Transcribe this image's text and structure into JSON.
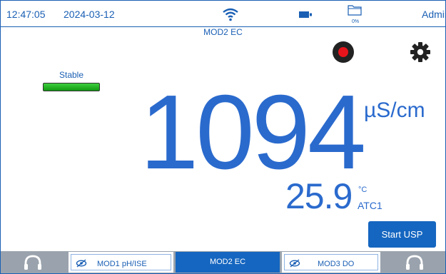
{
  "status_bar": {
    "time": "12:47:05",
    "date": "2024-03-12",
    "storage_percent": "0%",
    "user": "Admin",
    "icons": [
      "wifi-icon",
      "battery-icon",
      "folder-icon"
    ]
  },
  "module_title": "MOD2 EC",
  "stability": {
    "label": "Stable",
    "color": "#22b422"
  },
  "measurement": {
    "value": "1094",
    "unit": "µS/cm"
  },
  "temperature": {
    "value": "25.9",
    "unit": "°C",
    "mode": "ATC1"
  },
  "actions": {
    "start_label": "Start USP",
    "record_icon": "record-icon",
    "settings_icon": "gear-icon"
  },
  "nav": {
    "tabs": [
      {
        "label": "MOD1 pH/ISE",
        "active": false,
        "hidden_icon": "eye-slash-icon"
      },
      {
        "label": "MOD2 EC",
        "active": true
      },
      {
        "label": "MOD3 DO",
        "active": false,
        "hidden_icon": "eye-slash-icon"
      }
    ],
    "prev_icon": "headset-icon",
    "next_icon": "headset-icon"
  },
  "colors": {
    "accent": "#1566c0",
    "text_blue": "#2a6acd",
    "nav_bg": "#9aa3ad",
    "record": "#e8141b"
  }
}
